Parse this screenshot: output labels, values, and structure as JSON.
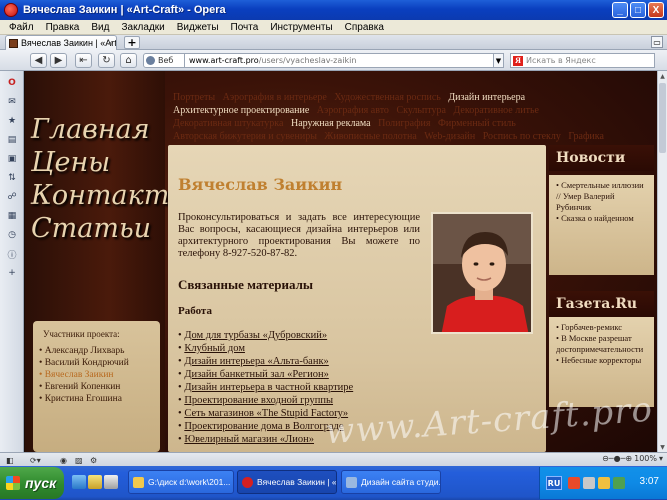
{
  "window": {
    "title": "Вячеслав Заикин | «Art-Craft» - Opera",
    "controls": [
      "_",
      "□",
      "X"
    ]
  },
  "menubar": [
    "Файл",
    "Правка",
    "Вид",
    "Закладки",
    "Виджеты",
    "Почта",
    "Инструменты",
    "Справка"
  ],
  "tabs": [
    {
      "label": "Вячеслав Заикин | «Art..."
    }
  ],
  "tab_close": "×",
  "new_tab": "+",
  "address": {
    "mode_label": "Веб",
    "host": "www.art-craft.pro",
    "path": "/users/vyacheslav-zaikin",
    "search_placeholder": "Искать в Яндекс",
    "search_logo": "Я"
  },
  "nav_buttons": [
    "◀",
    "▶",
    "⇤",
    "↻",
    "⌂"
  ],
  "side_panel_icons": [
    "opera-icon",
    "mail-icon",
    "bookmarks-icon",
    "notes-icon",
    "widgets-icon",
    "transfers-icon",
    "links-icon",
    "history-icon",
    "info-icon",
    "add-panel-icon"
  ],
  "site": {
    "top_nav": [
      {
        "label": "Портреты",
        "bright": false
      },
      {
        "label": "Аэрография в интерьере",
        "bright": false
      },
      {
        "label": "Художественная роспись",
        "bright": false
      },
      {
        "label": "Дизайн интерьера",
        "bright": true
      },
      {
        "label": "Архитектурное проектирование",
        "bright": true
      },
      {
        "label": "Аэрография авто",
        "bright": false
      },
      {
        "label": "Скульптура",
        "bright": false
      },
      {
        "label": "Декоративное литье",
        "bright": false
      },
      {
        "label": "Декоративная штукатурка",
        "bright": false
      },
      {
        "label": "Наружная реклама",
        "bright": true
      },
      {
        "label": "Полиграфия",
        "bright": false
      },
      {
        "label": "Фирменный стиль",
        "bright": false
      },
      {
        "label": "Авторская бижутерия и сувениры",
        "bright": false
      },
      {
        "label": "Живописные полотна",
        "bright": false
      },
      {
        "label": "Web-дизайн",
        "bright": false
      },
      {
        "label": "Роспись по стеклу",
        "bright": false
      },
      {
        "label": "Графика",
        "bright": false
      }
    ],
    "main_nav": [
      "Главная",
      "Цены",
      "Контакты",
      "Статьи"
    ],
    "participants": {
      "heading": "Участники проекта:",
      "items": [
        {
          "name": "Александр Лихварь",
          "current": false
        },
        {
          "name": "Василий Кондрючий",
          "current": false
        },
        {
          "name": "Вячеслав Заикин",
          "current": true
        },
        {
          "name": "Евгений Копенкин",
          "current": false
        },
        {
          "name": "Кристина Егошина",
          "current": false
        }
      ]
    },
    "content": {
      "title": "Вячеслав Заикин",
      "intro": "Проконсультироваться и задать все интересующие Вас вопросы, касающиеся дизайна интерьеров или архитектурного проектирования Вы можете по телефону 8-927-520-87-82.",
      "related_heading": "Связанные материалы",
      "works_heading": "Работа",
      "works": [
        "Дом для турбазы «Дубровский»",
        "Клубный дом",
        "Дизайн интерьера «Альта-банк»",
        "Дизайн банкетный зал «Регион»",
        "Дизайн интерьера в частной квартире",
        "Проектирование входной группы",
        "Сеть магазинов «The Stupid Factory»",
        "Проектирование дома в Волгограде",
        "Ювелирный магазин «Лион»"
      ]
    },
    "news": {
      "heading": "Новости",
      "items": [
        "Смертельные иллюзии // Умер Валерий Рубинчик",
        "Сказка о найденном"
      ]
    },
    "gazeta": {
      "heading": "Газета.Ru",
      "items": [
        "Горбачев-ремикс",
        "В Москве разрешат достопримечательности",
        "Небесные корректоры"
      ]
    },
    "watermark": "www.Art-craft.pro"
  },
  "statusbar": {
    "zoom": "100%"
  },
  "taskbar": {
    "start_label": "пуск",
    "tasks": [
      {
        "label": "G:\\диск d:\\work\\201...",
        "active": false,
        "icon_color": "#f2c94c"
      },
      {
        "label": "Вячеслав Заикин | «...",
        "active": true,
        "icon_color": "#d62020"
      },
      {
        "label": "Дизайн сайта студи...",
        "active": false,
        "icon_color": "#9ab8e0"
      }
    ],
    "lang": "RU",
    "clock": "3:07"
  },
  "colors": {
    "accent_gold": "#c08030",
    "highlight_participant": "#b86a20",
    "xp_blue": "#245edb",
    "start_green": "#2f8a2d"
  }
}
